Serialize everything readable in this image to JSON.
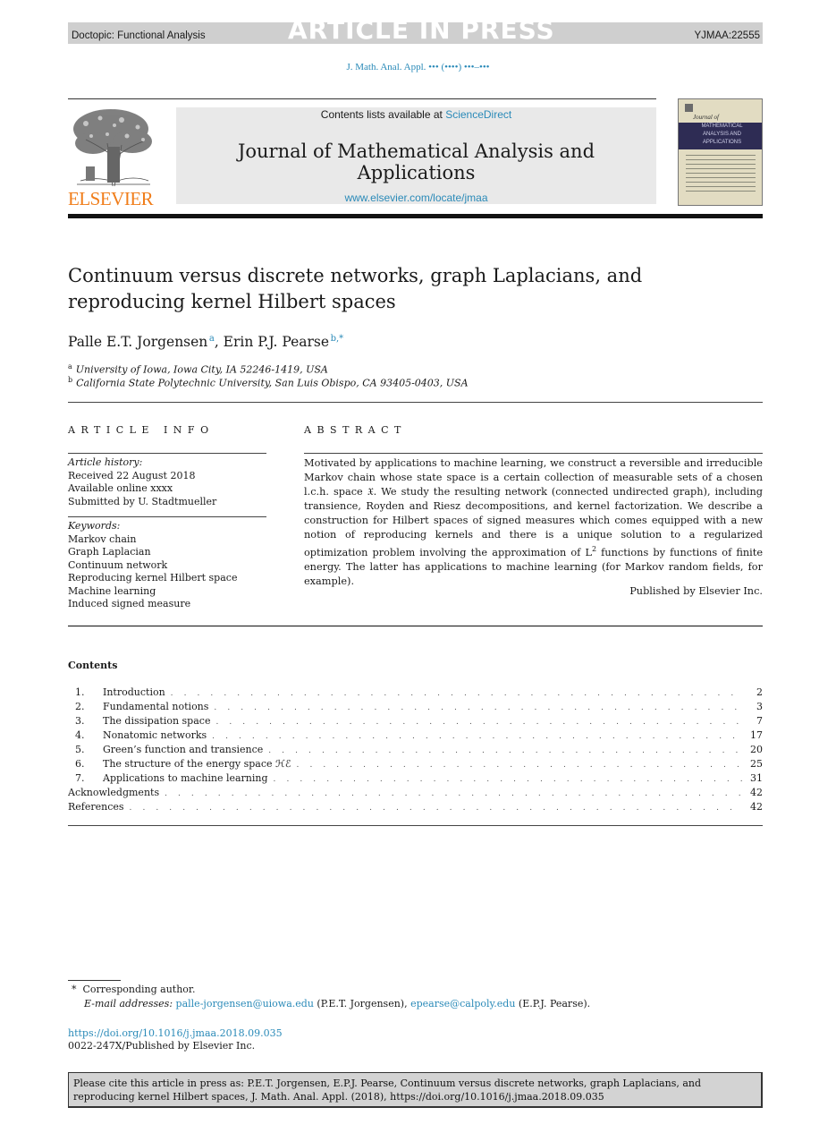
{
  "banner": {
    "doctopic": "Doctopic: Functional Analysis",
    "status": "ARTICLE IN PRESS",
    "article_id": "YJMAA:22555"
  },
  "journal_ref": "J. Math. Anal. Appl. ••• (••••) •••–•••",
  "masthead": {
    "publisher_logo_text": "ELSEVIER",
    "contents_prefix": "Contents lists available at ",
    "contents_link": "ScienceDirect",
    "journal_title": "Journal of Mathematical Analysis and Applications",
    "journal_url": "www.elsevier.com/locate/jmaa",
    "cover": {
      "script": "Journal of",
      "title_lines": [
        "MATHEMATICAL",
        "ANALYSIS AND",
        "APPLICATIONS"
      ]
    }
  },
  "colors": {
    "link": "#2a8ab8",
    "elsevier_orange": "#f07d1a",
    "banner_gray": "#cfcfcf",
    "masthead_gray": "#e9e9e9",
    "cite_box_gray": "#d3d3d3"
  },
  "paper": {
    "title_line1": "Continuum versus discrete networks, graph Laplacians, and",
    "title_line2": "reproducing kernel Hilbert spaces",
    "authors": [
      {
        "name": "Palle E.T. Jorgensen",
        "sup": "a"
      },
      {
        "name": "Erin P.J. Pearse",
        "sup": "b,*"
      }
    ],
    "author_separator": ", ",
    "affiliations": [
      {
        "sup": "a",
        "text": "University of Iowa, Iowa City, IA 52246-1419, USA"
      },
      {
        "sup": "b",
        "text": "California State Polytechnic University, San Luis Obispo, CA 93405-0403, USA"
      }
    ]
  },
  "article_info": {
    "heading": "ARTICLE INFO",
    "history_label": "Article history:",
    "history": [
      "Received 22 August 2018",
      "Available online xxxx",
      "Submitted by U. Stadtmueller"
    ],
    "keywords_label": "Keywords:",
    "keywords": [
      "Markov chain",
      "Graph Laplacian",
      "Continuum network",
      "Reproducing kernel Hilbert space",
      "Machine learning",
      "Induced signed measure"
    ]
  },
  "abstract": {
    "heading": "ABSTRACT",
    "text_before_sup": "Motivated by applications to machine learning, we construct a reversible and irreducible Markov chain whose state space is a certain collection of measurable sets of a chosen l.c.h. space 𝔛. We study the resulting network (connected undirected graph), including transience, Royden and Riesz decompositions, and kernel factorization. We describe a construction for Hilbert spaces of signed measures which comes equipped with a new notion of reproducing kernels and there is a unique solution to a regularized optimization problem involving the approximation of L",
    "sup": "2",
    "text_after_sup": " functions by functions of finite energy. The latter has applications to machine learning (for Markov random fields, for example).",
    "published_by": "Published by Elsevier Inc."
  },
  "contents": {
    "heading": "Contents",
    "items": [
      {
        "num": "1.",
        "title": "Introduction",
        "page": "2"
      },
      {
        "num": "2.",
        "title": "Fundamental notions",
        "page": "3"
      },
      {
        "num": "3.",
        "title": "The dissipation space",
        "page": "7"
      },
      {
        "num": "4.",
        "title": "Nonatomic networks",
        "page": "17"
      },
      {
        "num": "5.",
        "title": "Green’s function and transience",
        "page": "20"
      },
      {
        "num": "6.",
        "title": "The structure of the energy space ℋℰ",
        "page": "25"
      },
      {
        "num": "7.",
        "title": "Applications to machine learning",
        "page": "31"
      },
      {
        "num": "",
        "title": "Acknowledgments",
        "page": "42"
      },
      {
        "num": "",
        "title": "References",
        "page": "42"
      }
    ]
  },
  "footnotes": {
    "corresponding_mark": "*",
    "corresponding_text": "Corresponding author.",
    "email_label": "E-mail addresses:",
    "emails": [
      {
        "address": "palle-jorgensen@uiowa.edu",
        "owner": " (P.E.T. Jorgensen), "
      },
      {
        "address": "epearse@calpoly.edu",
        "owner": " (E.P.J. Pearse)."
      }
    ],
    "doi": "https://doi.org/10.1016/j.jmaa.2018.09.035",
    "issn": "0022-247X/Published by Elsevier Inc."
  },
  "citation_box": "Please cite this article in press as: P.E.T. Jorgensen, E.P.J. Pearse, Continuum versus discrete networks, graph Laplacians, and reproducing kernel Hilbert spaces, J. Math. Anal. Appl. (2018), https://doi.org/10.1016/j.jmaa.2018.09.035"
}
